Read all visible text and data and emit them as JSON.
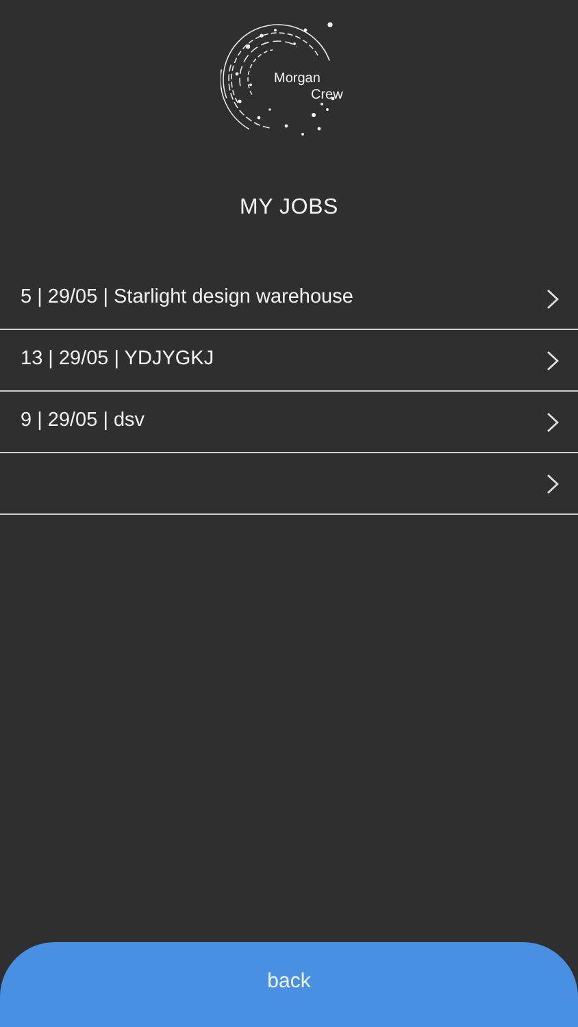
{
  "logo": {
    "line_1": "Morgan",
    "line_2": "Crew"
  },
  "title": "MY JOBS",
  "jobs": [
    {
      "kind": "job",
      "label": "5 | 29/05 | Starlight design warehouse"
    },
    {
      "kind": "job",
      "label": "13 | 29/05 | YDJYGKJ"
    },
    {
      "kind": "job",
      "label": "9 | 29/05 | dsv"
    },
    {
      "kind": "blank"
    }
  ],
  "back_button": "back"
}
